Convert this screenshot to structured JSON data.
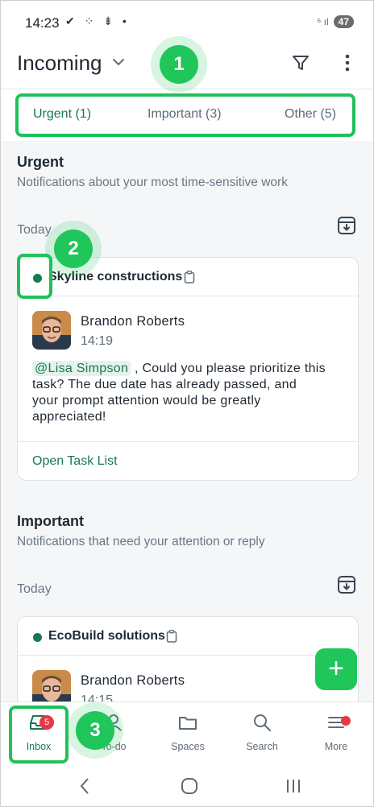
{
  "status_bar": {
    "time": "14:23",
    "left_icons": "✔ ⁘ ⇟ •",
    "network": "⁶ ıl",
    "battery": "47"
  },
  "header": {
    "title": "Incoming"
  },
  "tabs": [
    {
      "label": "Urgent (1)",
      "active": true
    },
    {
      "label": "Important (3)",
      "active": false
    },
    {
      "label": "Other (5)",
      "active": false
    }
  ],
  "sections": [
    {
      "title": "Urgent",
      "subtitle": "Notifications about your most time-sensitive work",
      "day": "Today",
      "card": {
        "project": "Skyline constructions",
        "sender": "Brandon Roberts",
        "time": "14:19",
        "mention": "@Lisa Simpson",
        "message_line1": " , Could you please prioritize this",
        "message_line2": "task? The due date has already passed, and",
        "message_line3": "your prompt attention would be greatly",
        "message_line4": "appreciated!",
        "footer_link": "Open Task List"
      }
    },
    {
      "title": "Important",
      "subtitle": "Notifications that need your attention or reply",
      "day": "Today",
      "card": {
        "project": "EcoBuild solutions",
        "sender": "Brandon Roberts",
        "time": "14:15"
      }
    }
  ],
  "fab": {
    "label": "+"
  },
  "bottom_nav": [
    {
      "label": "Inbox",
      "icon": "inbox-icon",
      "badge": "5",
      "active": true
    },
    {
      "label": "To-do",
      "icon": "person-icon",
      "badge": "",
      "active": false
    },
    {
      "label": "Spaces",
      "icon": "folder-icon",
      "badge": "",
      "active": false
    },
    {
      "label": "Search",
      "icon": "search-icon",
      "badge": "",
      "active": false
    },
    {
      "label": "More",
      "icon": "menu-icon",
      "badge": "",
      "active": false
    }
  ],
  "markers": [
    "1",
    "2",
    "3"
  ],
  "colors": {
    "accent": "#167a4e",
    "highlight": "#1ec15a",
    "badge": "#e53945"
  }
}
